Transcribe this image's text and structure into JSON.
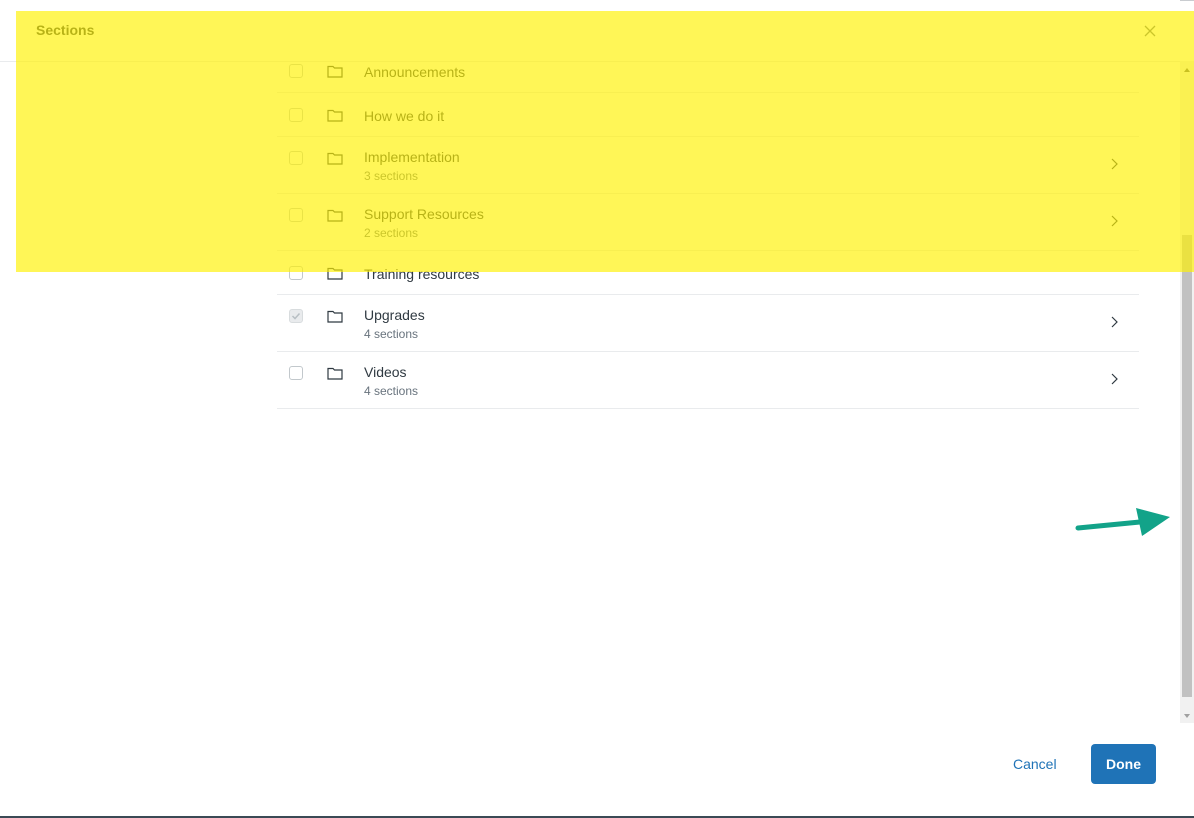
{
  "modal": {
    "title": "Sections",
    "close_icon": "close-icon"
  },
  "sections": [
    {
      "label": "Announcements",
      "sub": "",
      "checked": false,
      "has_children": false
    },
    {
      "label": "How we do it",
      "sub": "",
      "checked": false,
      "has_children": false
    },
    {
      "label": "Implementation",
      "sub": "3 sections",
      "checked": false,
      "has_children": true
    },
    {
      "label": "Support Resources",
      "sub": "2 sections",
      "checked": false,
      "has_children": true
    },
    {
      "label": "Training resources",
      "sub": "",
      "checked": false,
      "has_children": false
    },
    {
      "label": "Upgrades",
      "sub": "4 sections",
      "checked": true,
      "has_children": true
    },
    {
      "label": "Videos",
      "sub": "4 sections",
      "checked": false,
      "has_children": true
    }
  ],
  "footer": {
    "cancel_label": "Cancel",
    "done_label": "Done"
  },
  "annotations": {
    "highlight_color": "#fff200",
    "arrow_color": "#12a389"
  },
  "colors": {
    "primary": "#1f73b7",
    "text": "#2f3941",
    "muted": "#68737d"
  }
}
